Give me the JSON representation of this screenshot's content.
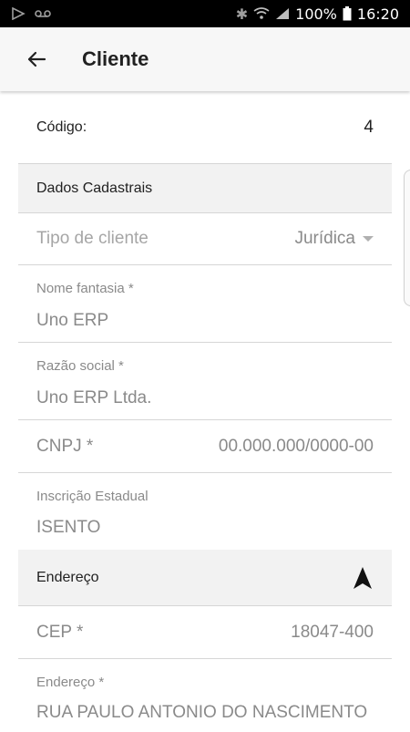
{
  "status_bar": {
    "battery": "100%",
    "time": "16:20"
  },
  "app_bar": {
    "title": "Cliente"
  },
  "form": {
    "codigo": {
      "label": "Código:",
      "value": "4"
    },
    "section_dados": {
      "title": "Dados Cadastrais"
    },
    "tipo_cliente": {
      "label": "Tipo de cliente",
      "value": "Jurídica"
    },
    "nome_fantasia": {
      "label": "Nome fantasia *",
      "value": "Uno ERP"
    },
    "razao_social": {
      "label": "Razão social *",
      "value": "Uno ERP Ltda."
    },
    "cnpj": {
      "label": "CNPJ *",
      "value": "00.000.000/0000-00"
    },
    "inscricao_estadual": {
      "label": "Inscrição Estadual",
      "value": "ISENTO"
    },
    "section_endereco": {
      "title": "Endereço"
    },
    "cep": {
      "label": "CEP *",
      "value": "18047-400"
    },
    "endereco": {
      "label": "Endereço *",
      "value": "RUA PAULO ANTONIO DO NASCIMENTO"
    }
  },
  "icons": {
    "back": "arrow-left-icon",
    "navigation": "navigation-arrow-icon",
    "dropdown": "caret-down-icon"
  }
}
